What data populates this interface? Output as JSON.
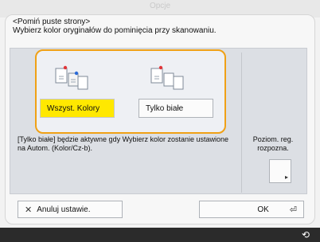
{
  "window": {
    "title": "Opcje"
  },
  "dialog": {
    "heading": "<Pomiń puste strony>",
    "instruction": "Wybierz kolor oryginałów do pominięcia przy skanowaniu.",
    "options": [
      {
        "label": "Wszyst. Kolory",
        "selected": true,
        "icon": "color-pages-icon"
      },
      {
        "label": "Tylko białe",
        "selected": false,
        "icon": "white-pages-icon"
      }
    ],
    "note": "[Tylko białe] będzie aktywne gdy Wybierz kolor zostanie ustawione na Autom. (Kolor/Cz-b).",
    "side": {
      "label": "Poziom. reg. rozpozna.",
      "button_icon": "adjust-icon"
    },
    "footer": {
      "cancel_label": "Anuluj ustawie.",
      "cancel_icon": "close-icon",
      "ok_label": "OK",
      "ok_icon": "enter-icon"
    }
  },
  "colors": {
    "accent": "#f0a116",
    "selected": "#ffe800"
  }
}
